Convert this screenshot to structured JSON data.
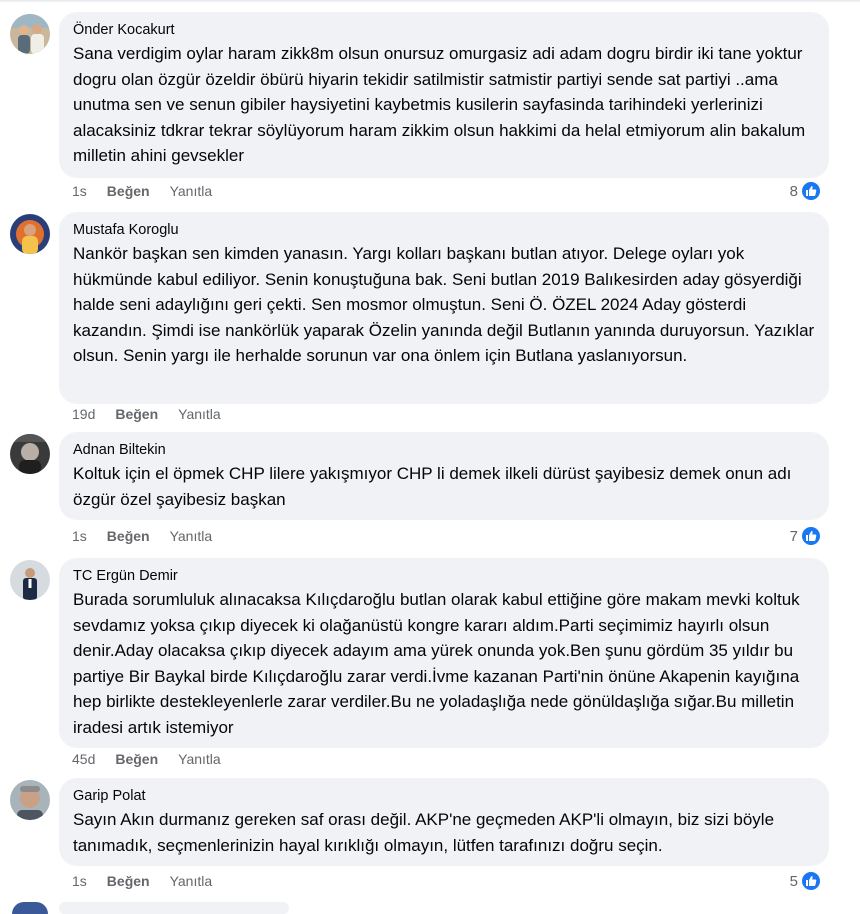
{
  "comments": [
    {
      "author": "Önder Kocakurt",
      "text": "Sana verdigim oylar haram zikk8m olsun onursuz omurgasiz adi adam dogru birdir iki tane yoktur dogru olan özgür özeldir öbürü hiyarin tekidir satilmistir satmistir partiyi sende sat partiyi ..ama unutma sen ve senun gibiler haysiyetini kaybetmis kusilerin sayfasinda tarihindeki yerlerinizi alacaksiniz tdkrar tekrar söylüyorum haram zikkim olsun hakkimi da helal etmiyorum alin bakalum milletin ahini gevsekler",
      "time": "1s",
      "like_label": "Beğen",
      "reply_label": "Yanıtla",
      "reaction_count": "8"
    },
    {
      "author": "Mustafa Koroglu",
      "text": "Nankör başkan sen kimden yanasın. Yargı kolları başkanı butlan atıyor. Delege oyları yok hükmünde kabul ediliyor. Senin konuştuğuna bak. Seni butlan 2019 Balıkesirden aday gösyerdiği halde seni adaylığını geri çekti. Sen mosmor olmuştun. Seni Ö. ÖZEL 2024 Aday gösterdi kazandın. Şimdi ise nankörlük yaparak Özelin yanında değil Butlanın yanında duruyorsun. Yazıklar olsun. Senin yargı ile herhalde sorunun var ona önlem için Butlana yaslanıyorsun.",
      "time": "19d",
      "like_label": "Beğen",
      "reply_label": "Yanıtla",
      "reaction_count": ""
    },
    {
      "author": "Adnan Biltekin",
      "text": "Koltuk için el öpmek CHP lilere yakışmıyor CHP li demek ilkeli dürüst şayibesiz demek onun adı özgür özel şayibesiz başkan",
      "time": "1s",
      "like_label": "Beğen",
      "reply_label": "Yanıtla",
      "reaction_count": "7"
    },
    {
      "author": "TC Ergün Demir",
      "text": "Burada sorumluluk alınacaksa Kılıçdaroğlu butlan olarak kabul ettiğine göre makam mevki koltuk sevdamız yoksa çıkıp diyecek ki olağanüstü kongre kararı aldım.Parti seçimimiz hayırlı olsun denir.Aday olacaksa çıkıp diyecek adayım ama yürek onunda yok.Ben şunu gördüm 35 yıldır bu partiye Bir Baykal birde Kılıçdaroğlu zarar verdi.İvme kazanan Parti'nin önüne Akapenin kayığına hep birlikte destekleyenlerle zarar verdiler.Bu ne yoladaşlığa nede gönüldaşlığa sığar.Bu milletin iradesi artık istemiyor",
      "time": "45d",
      "like_label": "Beğen",
      "reply_label": "Yanıtla",
      "reaction_count": ""
    },
    {
      "author": "Garip Polat",
      "text": "Sayın Akın durmanız gereken saf orası değil. AKP'ne geçmeden AKP'li olmayın, biz sizi böyle tanımadık, seçmenlerinizin hayal kırıklığı olmayın, lütfen tarafınızı doğru seçin.",
      "time": "1s",
      "like_label": "Beğen",
      "reply_label": "Yanıtla",
      "reaction_count": "5"
    }
  ],
  "colors": {
    "bubble": "#f0f2f5",
    "secondary_text": "#65676b",
    "like_blue": "#1877f2"
  },
  "icons": {
    "reaction": "like-thumb-icon"
  }
}
